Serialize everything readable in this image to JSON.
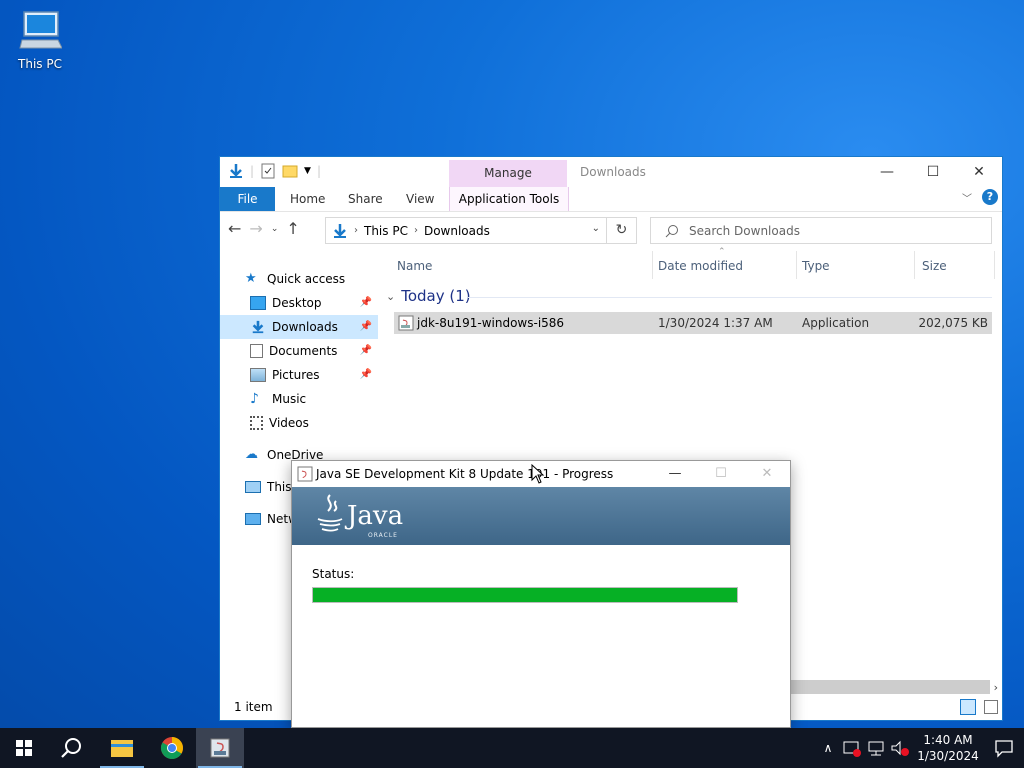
{
  "desktop": {
    "icons": [
      {
        "label": "This PC",
        "icon": "this-pc-icon"
      }
    ]
  },
  "explorer": {
    "title": "Downloads",
    "manage_tab": "Manage",
    "ribbon_tabs": {
      "file": "File",
      "home": "Home",
      "share": "Share",
      "view": "View",
      "app_tools": "Application Tools"
    },
    "address": {
      "root": "This PC",
      "folder": "Downloads"
    },
    "search_placeholder": "Search Downloads",
    "sidebar": {
      "quick_access": "Quick access",
      "items": [
        {
          "label": "Desktop",
          "pinned": true
        },
        {
          "label": "Downloads",
          "pinned": true,
          "selected": true
        },
        {
          "label": "Documents",
          "pinned": true
        },
        {
          "label": "Pictures",
          "pinned": true
        },
        {
          "label": "Music",
          "pinned": false
        },
        {
          "label": "Videos",
          "pinned": false
        }
      ],
      "onedrive": "OneDrive",
      "this_pc": "This PC",
      "network": "Network"
    },
    "columns": {
      "name": "Name",
      "date": "Date modified",
      "type": "Type",
      "size": "Size"
    },
    "group": "Today (1)",
    "files": [
      {
        "name": "jdk-8u191-windows-i586",
        "date": "1/30/2024 1:37 AM",
        "type": "Application",
        "size": "202,075 KB"
      }
    ],
    "status": "1 item"
  },
  "dialog": {
    "title": "Java SE Development Kit 8 Update 191 - Progress",
    "brand": "Java",
    "sub_brand": "ORACLE",
    "status_label": "Status:",
    "progress": 1.0
  },
  "taskbar": {
    "clock_time": "1:40 AM",
    "clock_date": "1/30/2024"
  },
  "colors": {
    "accent": "#1979ca",
    "progress": "#06b025",
    "taskbar": "#101623"
  }
}
